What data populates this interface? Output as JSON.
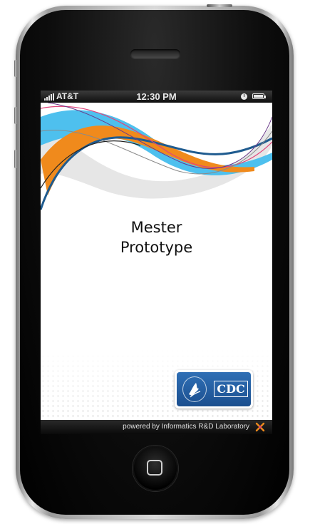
{
  "status_bar": {
    "carrier": "AT&T",
    "time": "12:30 PM",
    "signal_icon": "signal-bars-icon",
    "clock_icon": "clock-icon",
    "battery_icon": "battery-icon"
  },
  "screen": {
    "title_line1": "Mester",
    "title_line2": "Prototype",
    "logo_text": "CDC",
    "footer_text": "powered by Informatics R&D Laboratory"
  },
  "colors": {
    "cdc_blue": "#1b4f8f",
    "swoosh_orange": "#f08a1c",
    "swoosh_lightblue": "#4ec0ee",
    "swoosh_darkblue": "#1f5b8f",
    "swoosh_pink": "#e0457b"
  }
}
